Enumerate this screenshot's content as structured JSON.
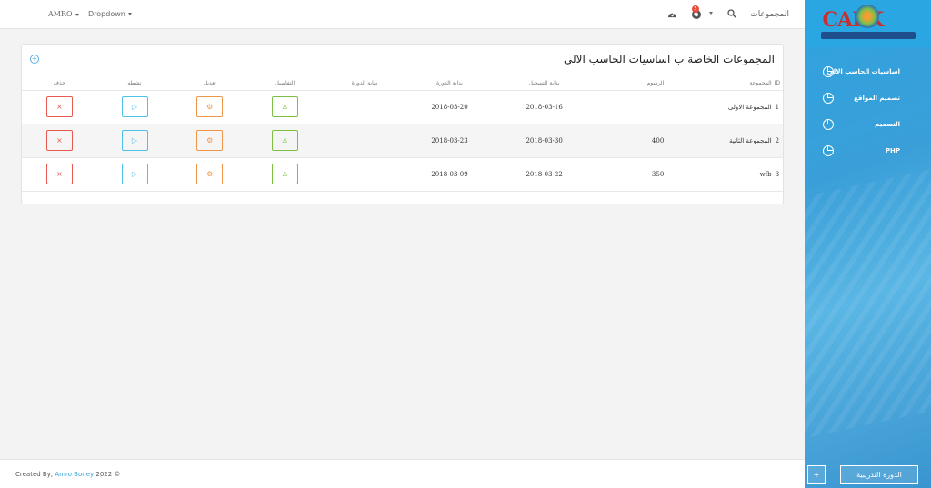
{
  "topbar": {
    "user": "AMRO",
    "dropdown": "Dropdown",
    "title": "المجموعات",
    "notification_count": "5"
  },
  "sidebar": {
    "items": [
      {
        "label": "اساسيات الحاسب الالي",
        "icon": "pie-chart-icon"
      },
      {
        "label": "تصميم المواقع",
        "icon": "pie-chart-icon"
      },
      {
        "label": "التصميم",
        "icon": "pie-chart-icon"
      },
      {
        "label": "PHP",
        "icon": "pie-chart-icon"
      }
    ],
    "course_button": "الدورة التدريبية",
    "add_button": "+"
  },
  "panel": {
    "title": "المجموعات الخاصة ب اساسيات الحاسب الالي",
    "columns": {
      "id": "ID",
      "group": "المجموعة",
      "fee": "الرسوم",
      "reg_start": "بداية التسجيل",
      "course_start": "بداية الدورة",
      "course_end": "نهاية الدورة",
      "details": "التفاصيل",
      "edit": "تعديل",
      "activate": "نشطه",
      "delete": "حذف"
    },
    "rows": [
      {
        "id": "1",
        "group": "المجموعة الاولى",
        "fee": "",
        "reg_start": "2018-03-16",
        "course_start": "2018-03-20",
        "course_end": ""
      },
      {
        "id": "2",
        "group": "المجموعة الثانية",
        "fee": "400",
        "reg_start": "2018-03-30",
        "course_start": "2018-03-23",
        "course_end": ""
      },
      {
        "id": "3",
        "group": "wfb",
        "fee": "350",
        "reg_start": "2018-03-22",
        "course_start": "2018-03-09",
        "course_end": ""
      }
    ]
  },
  "footer": {
    "prefix": "Created By,",
    "author": "Amro Boney",
    "suffix": "2022 ©"
  }
}
